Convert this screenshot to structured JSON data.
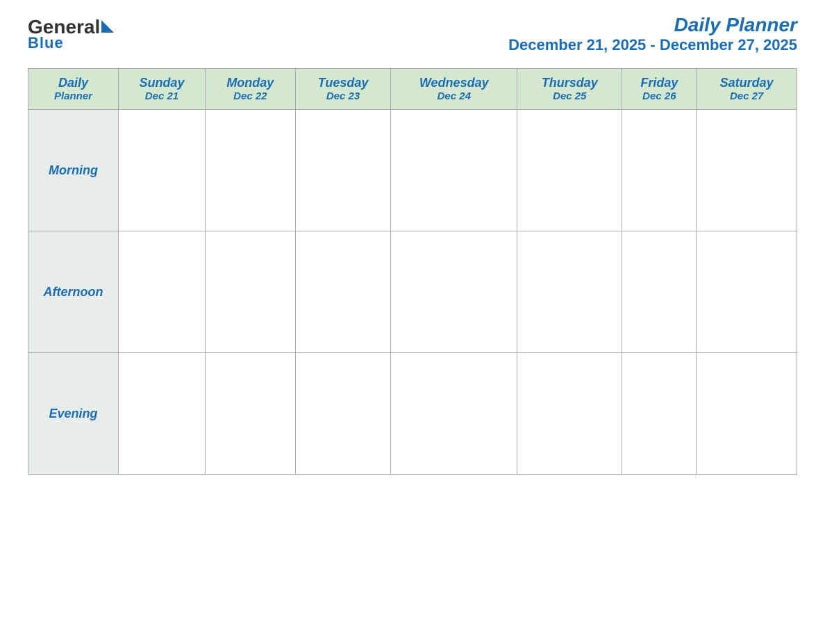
{
  "header": {
    "logo": {
      "general": "General",
      "blue": "Blue",
      "tagline": "Blue"
    },
    "title": "Daily Planner",
    "date_range": "December 21, 2025 - December 27, 2025"
  },
  "table": {
    "corner_label_line1": "Daily",
    "corner_label_line2": "Planner",
    "columns": [
      {
        "day": "Sunday",
        "date": "Dec 21"
      },
      {
        "day": "Monday",
        "date": "Dec 22"
      },
      {
        "day": "Tuesday",
        "date": "Dec 23"
      },
      {
        "day": "Wednesday",
        "date": "Dec 24"
      },
      {
        "day": "Thursday",
        "date": "Dec 25"
      },
      {
        "day": "Friday",
        "date": "Dec 26"
      },
      {
        "day": "Saturday",
        "date": "Dec 27"
      }
    ],
    "rows": [
      {
        "label": "Morning"
      },
      {
        "label": "Afternoon"
      },
      {
        "label": "Evening"
      }
    ]
  }
}
